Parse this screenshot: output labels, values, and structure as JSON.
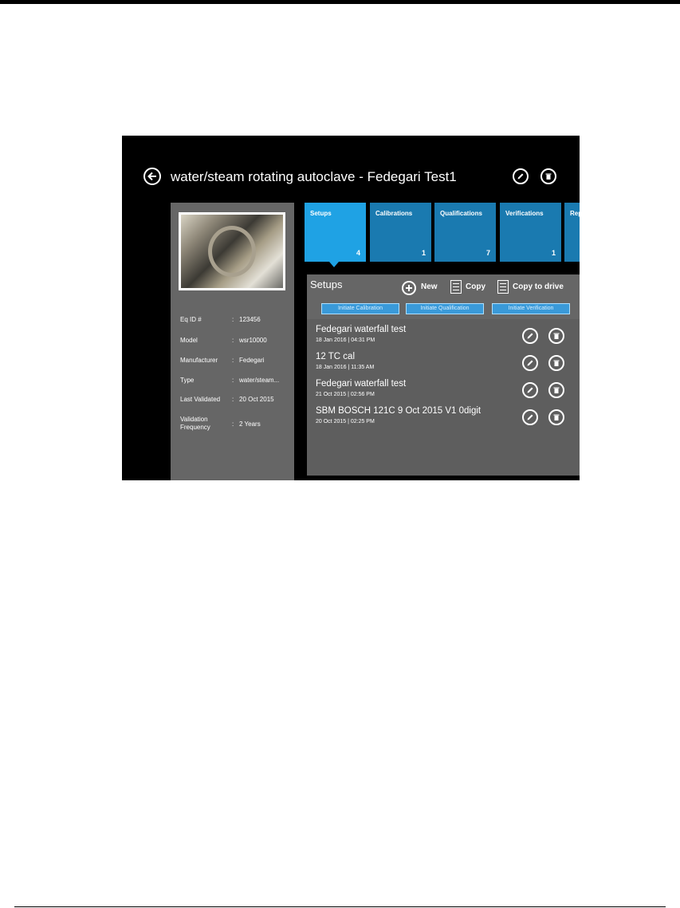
{
  "header": {
    "title": "water/steam rotating autoclave - Fedegari Test1"
  },
  "equipment": {
    "rows": [
      {
        "label": "Eq ID #",
        "value": "123456"
      },
      {
        "label": "Model",
        "value": "wsr10000"
      },
      {
        "label": "Manufacturer",
        "value": "Fedegari"
      },
      {
        "label": "Type",
        "value": "water/steam..."
      },
      {
        "label": "Last Validated",
        "value": "20 Oct 2015"
      },
      {
        "label": "Validation Frequency",
        "value": "2 Years"
      }
    ]
  },
  "tiles": [
    {
      "label": "Setups",
      "count": "4"
    },
    {
      "label": "Calibrations",
      "count": "1"
    },
    {
      "label": "Qualifications",
      "count": "7"
    },
    {
      "label": "Verifications",
      "count": "1"
    },
    {
      "label": "Rep",
      "count": ""
    }
  ],
  "setups": {
    "title": "Setups",
    "actions": {
      "new": "New",
      "copy": "Copy",
      "copy_drive": "Copy to drive"
    },
    "initiate": [
      "Initiate Calibration",
      "Initiate Qualification",
      "Initiate Verification"
    ],
    "items": [
      {
        "title": "Fedegari waterfall test",
        "date": "18 Jan 2016 | 04:31  PM"
      },
      {
        "title": "12 TC cal",
        "date": "18 Jan 2016 | 11:35  AM"
      },
      {
        "title": "Fedegari waterfall test",
        "date": "21 Oct 2015 | 02:56  PM"
      },
      {
        "title": "SBM BOSCH 121C 9 Oct 2015 V1 0digit",
        "date": "20 Oct 2015 | 02:25  PM"
      }
    ]
  },
  "colors": {
    "tile": "#1a7ab0",
    "tile_active": "#1fa2e4",
    "panel": "#666666",
    "background": "#000000"
  },
  "icons": {
    "back": "back-arrow-icon",
    "edit": "pencil-icon",
    "delete": "trash-icon",
    "new": "plus-circle-icon",
    "copy": "document-icon"
  }
}
